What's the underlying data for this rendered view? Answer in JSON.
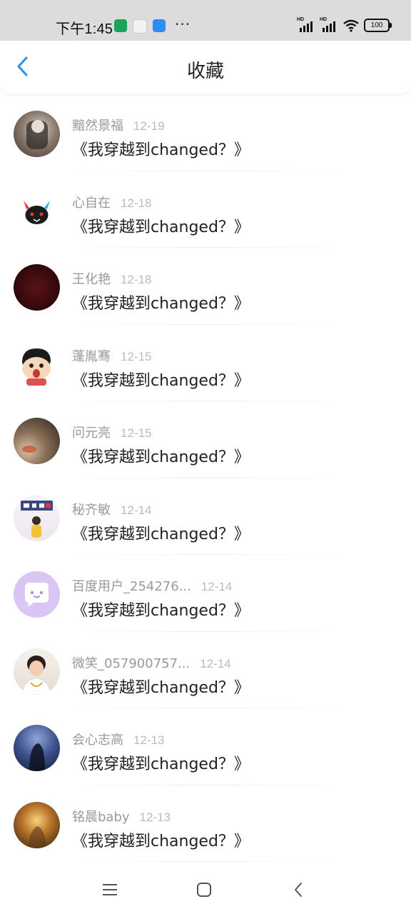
{
  "status_bar": {
    "time": "下午1:45",
    "app_icons": [
      "app-notification-icon",
      "game-icon",
      "message-icon"
    ],
    "more": "···",
    "battery": "100"
  },
  "header": {
    "title": "收藏"
  },
  "items": [
    {
      "name": "黯然景福",
      "date": "12-19",
      "title": "《我穿越到changed？》"
    },
    {
      "name": "心自在",
      "date": "12-18",
      "title": "《我穿越到changed？》"
    },
    {
      "name": "王化艳",
      "date": "12-18",
      "title": "《我穿越到changed？》"
    },
    {
      "name": "蓬胤骞",
      "date": "12-15",
      "title": "《我穿越到changed？》"
    },
    {
      "name": "问元亮",
      "date": "12-15",
      "title": "《我穿越到changed？》"
    },
    {
      "name": "秘齐敏",
      "date": "12-14",
      "title": "《我穿越到changed？》"
    },
    {
      "name": "百度用户_254276...",
      "date": "12-14",
      "title": "《我穿越到changed？》"
    },
    {
      "name": "微笑_057900757...",
      "date": "12-14",
      "title": "《我穿越到changed？》"
    },
    {
      "name": "会心志高",
      "date": "12-13",
      "title": "《我穿越到changed？》"
    },
    {
      "name": "铭晨baby",
      "date": "12-13",
      "title": "《我穿越到changed？》"
    }
  ],
  "colors": {
    "accent": "#2196F3",
    "status_bar_bg": "#DCDCDC",
    "name_text": "#999999",
    "date_text": "#BBBBBB"
  }
}
